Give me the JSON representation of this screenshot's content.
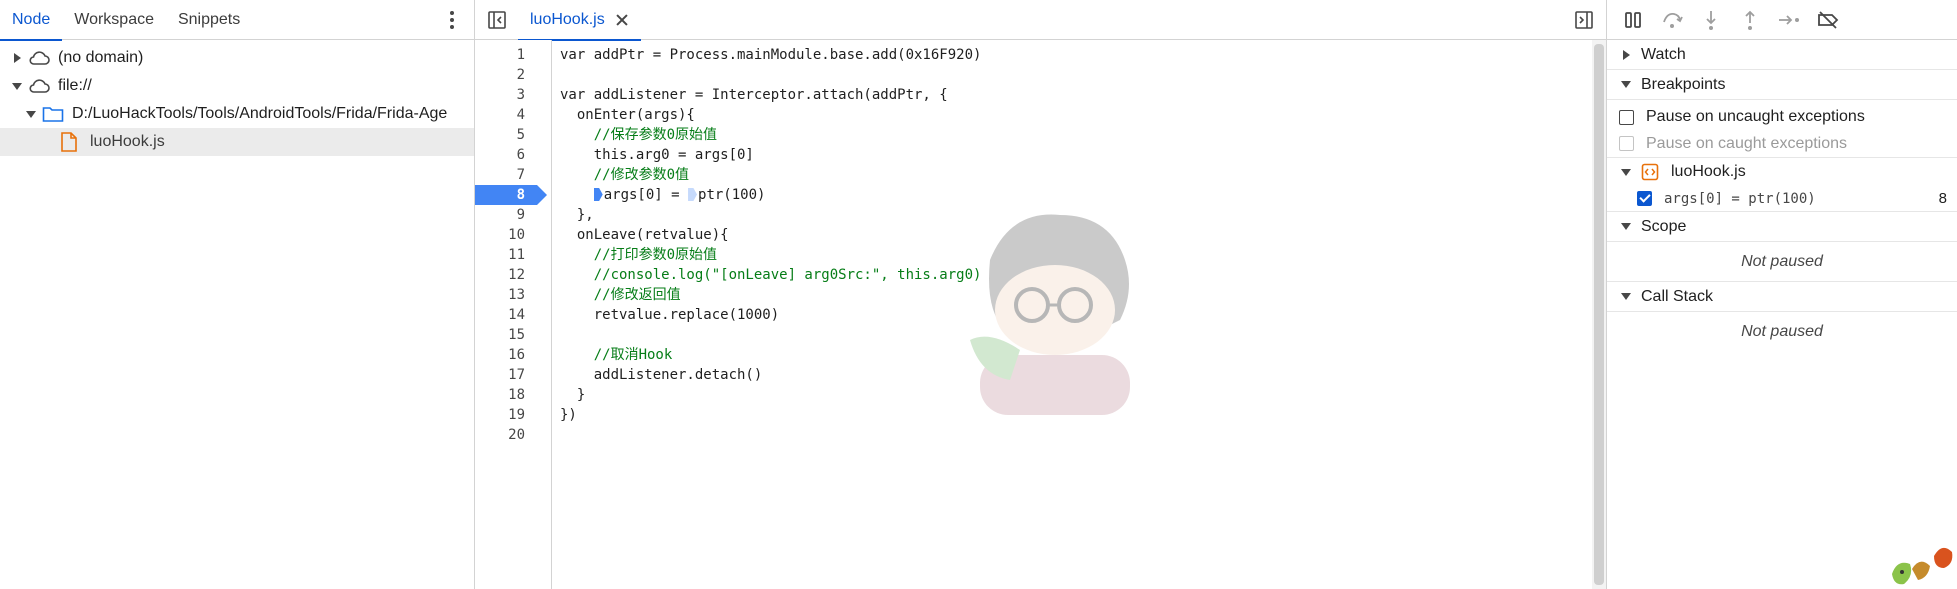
{
  "navigator": {
    "tabs": [
      "Node",
      "Workspace",
      "Snippets"
    ],
    "active_tab": "Node",
    "tree": {
      "no_domain": "(no domain)",
      "file_root": "file://",
      "folder": "D:/LuoHackTools/Tools/AndroidTools/Frida/Frida-Age",
      "file": "luoHook.js"
    }
  },
  "editor": {
    "tab_name": "luoHook.js",
    "active_line": "8",
    "line_numbers": [
      "1",
      "2",
      "3",
      "4",
      "5",
      "6",
      "7",
      "8",
      "9",
      "10",
      "11",
      "12",
      "13",
      "14",
      "15",
      "16",
      "17",
      "18",
      "19",
      "20"
    ],
    "code": {
      "l1": "var addPtr = Process.mainModule.base.add(0x16F920)",
      "l3": "var addListener = Interceptor.attach(addPtr, {",
      "l4": "  onEnter(args){",
      "l5": "    //保存参数0原始值",
      "l6": "    this.arg0 = args[0]",
      "l7": "    //修改参数0值",
      "l8a": "args[0] = ",
      "l8b": "ptr(100)",
      "l9": "  },",
      "l10": "  onLeave(retvalue){",
      "l11": "    //打印参数0原始值",
      "l12": "    //console.log(\"[onLeave] arg0Src:\", this.arg0)",
      "l13": "    //修改返回值",
      "l14": "    retvalue.replace(1000)",
      "l16": "    //取消Hook",
      "l17": "    addListener.detach()",
      "l18": "  }",
      "l19": "})"
    }
  },
  "debugger": {
    "sections": {
      "watch": "Watch",
      "breakpoints": "Breakpoints",
      "scope": "Scope",
      "call_stack": "Call Stack"
    },
    "pause_uncaught": "Pause on uncaught exceptions",
    "pause_caught": "Pause on caught exceptions",
    "bp_file": "luoHook.js",
    "bp_entry": {
      "code": "args[0] = ptr(100)",
      "line": "8",
      "checked": true
    },
    "scope_status": "Not paused",
    "callstack_status": "Not paused"
  },
  "colors": {
    "accent": "#0b57d0",
    "breakpoint": "#4285f4",
    "comment": "#067d17",
    "keyword": "#1a1aa6"
  }
}
